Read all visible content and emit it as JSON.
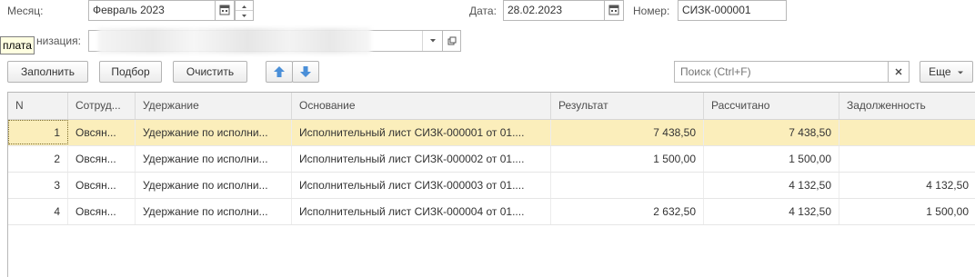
{
  "header": {
    "month_label": "Месяц:",
    "month_value": "Февраль 2023",
    "date_label": "Дата:",
    "date_value": "28.02.2023",
    "number_label": "Номер:",
    "number_value": "СИЗК-000001",
    "org_label": "Организация:",
    "org_label_visible": "низация:",
    "org_value": ""
  },
  "tooltip": {
    "text": "Оплата",
    "visible_text": "плата"
  },
  "toolbar": {
    "fill_label": "Заполнить",
    "select_label": "Подбор",
    "clear_label": "Очистить",
    "search_placeholder": "Поиск (Ctrl+F)",
    "more_label": "Еще"
  },
  "table": {
    "columns": [
      "N",
      "Сотрудник",
      "Удержание",
      "Основание",
      "Результат",
      "Рассчитано",
      "Задолженность"
    ],
    "columns_visible": [
      "N",
      "Сотруд...",
      "Удержание",
      "Основание",
      "Результат",
      "Рассчитано",
      "Задолженность"
    ],
    "rows": [
      {
        "n": "1",
        "employee": "Овсян...",
        "deduction": "Удержание по исполни...",
        "basis": "Исполнительный лист СИЗК-000001 от 01....",
        "result": "7 438,50",
        "calculated": "7 438,50",
        "debt": ""
      },
      {
        "n": "2",
        "employee": "Овсян...",
        "deduction": "Удержание по исполни...",
        "basis": "Исполнительный лист СИЗК-000002 от 01....",
        "result": "1 500,00",
        "calculated": "1 500,00",
        "debt": ""
      },
      {
        "n": "3",
        "employee": "Овсян...",
        "deduction": "Удержание по исполни...",
        "basis": "Исполнительный лист СИЗК-000003 от 01....",
        "result": "",
        "calculated": "4 132,50",
        "debt": "4 132,50"
      },
      {
        "n": "4",
        "employee": "Овсян...",
        "deduction": "Удержание по исполни...",
        "basis": "Исполнительный лист СИЗК-000004 от 01....",
        "result": "2 632,50",
        "calculated": "4 132,50",
        "debt": "1 500,00"
      }
    ],
    "selected_row": 1
  },
  "colors": {
    "selected_row": "#fbeebb",
    "header_bg": "#f2f2f2",
    "arrow_blue": "#4a8fd8"
  },
  "icons": [
    "calendar-icon",
    "spin-up-icon",
    "spin-down-icon",
    "dropdown-arrow-icon",
    "open-form-icon",
    "move-up-icon",
    "move-down-icon",
    "clear-search-icon",
    "more-dropdown-icon"
  ]
}
